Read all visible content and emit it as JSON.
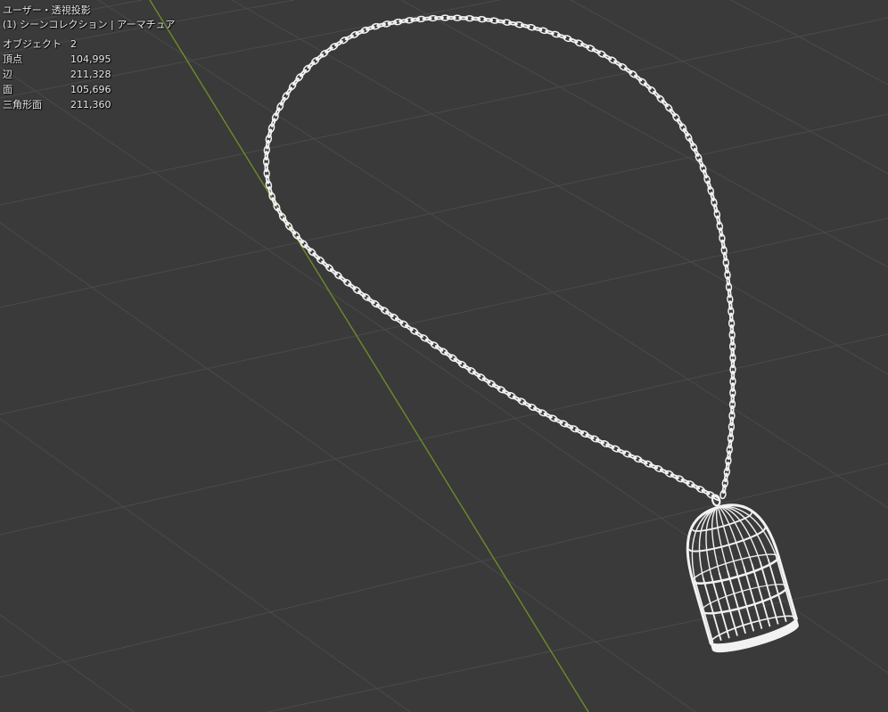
{
  "viewport": {
    "view_label": "ユーザー・透視投影",
    "collection_label": "(1) シーンコレクション | アーマチュア",
    "background_color": "#3a3a3a",
    "grid_color": "#4a4a4a",
    "y_axis_color": "#6b8c2a",
    "object_color": "#f2f2f2",
    "objects": [
      "chain-necklace",
      "birdcage-pendant"
    ]
  },
  "stats": [
    {
      "label": "オブジェクト",
      "value": "2"
    },
    {
      "label": "頂点",
      "value": "104,995"
    },
    {
      "label": "辺",
      "value": "211,328"
    },
    {
      "label": "面",
      "value": "105,696"
    },
    {
      "label": "三角形面",
      "value": "211,360"
    }
  ]
}
